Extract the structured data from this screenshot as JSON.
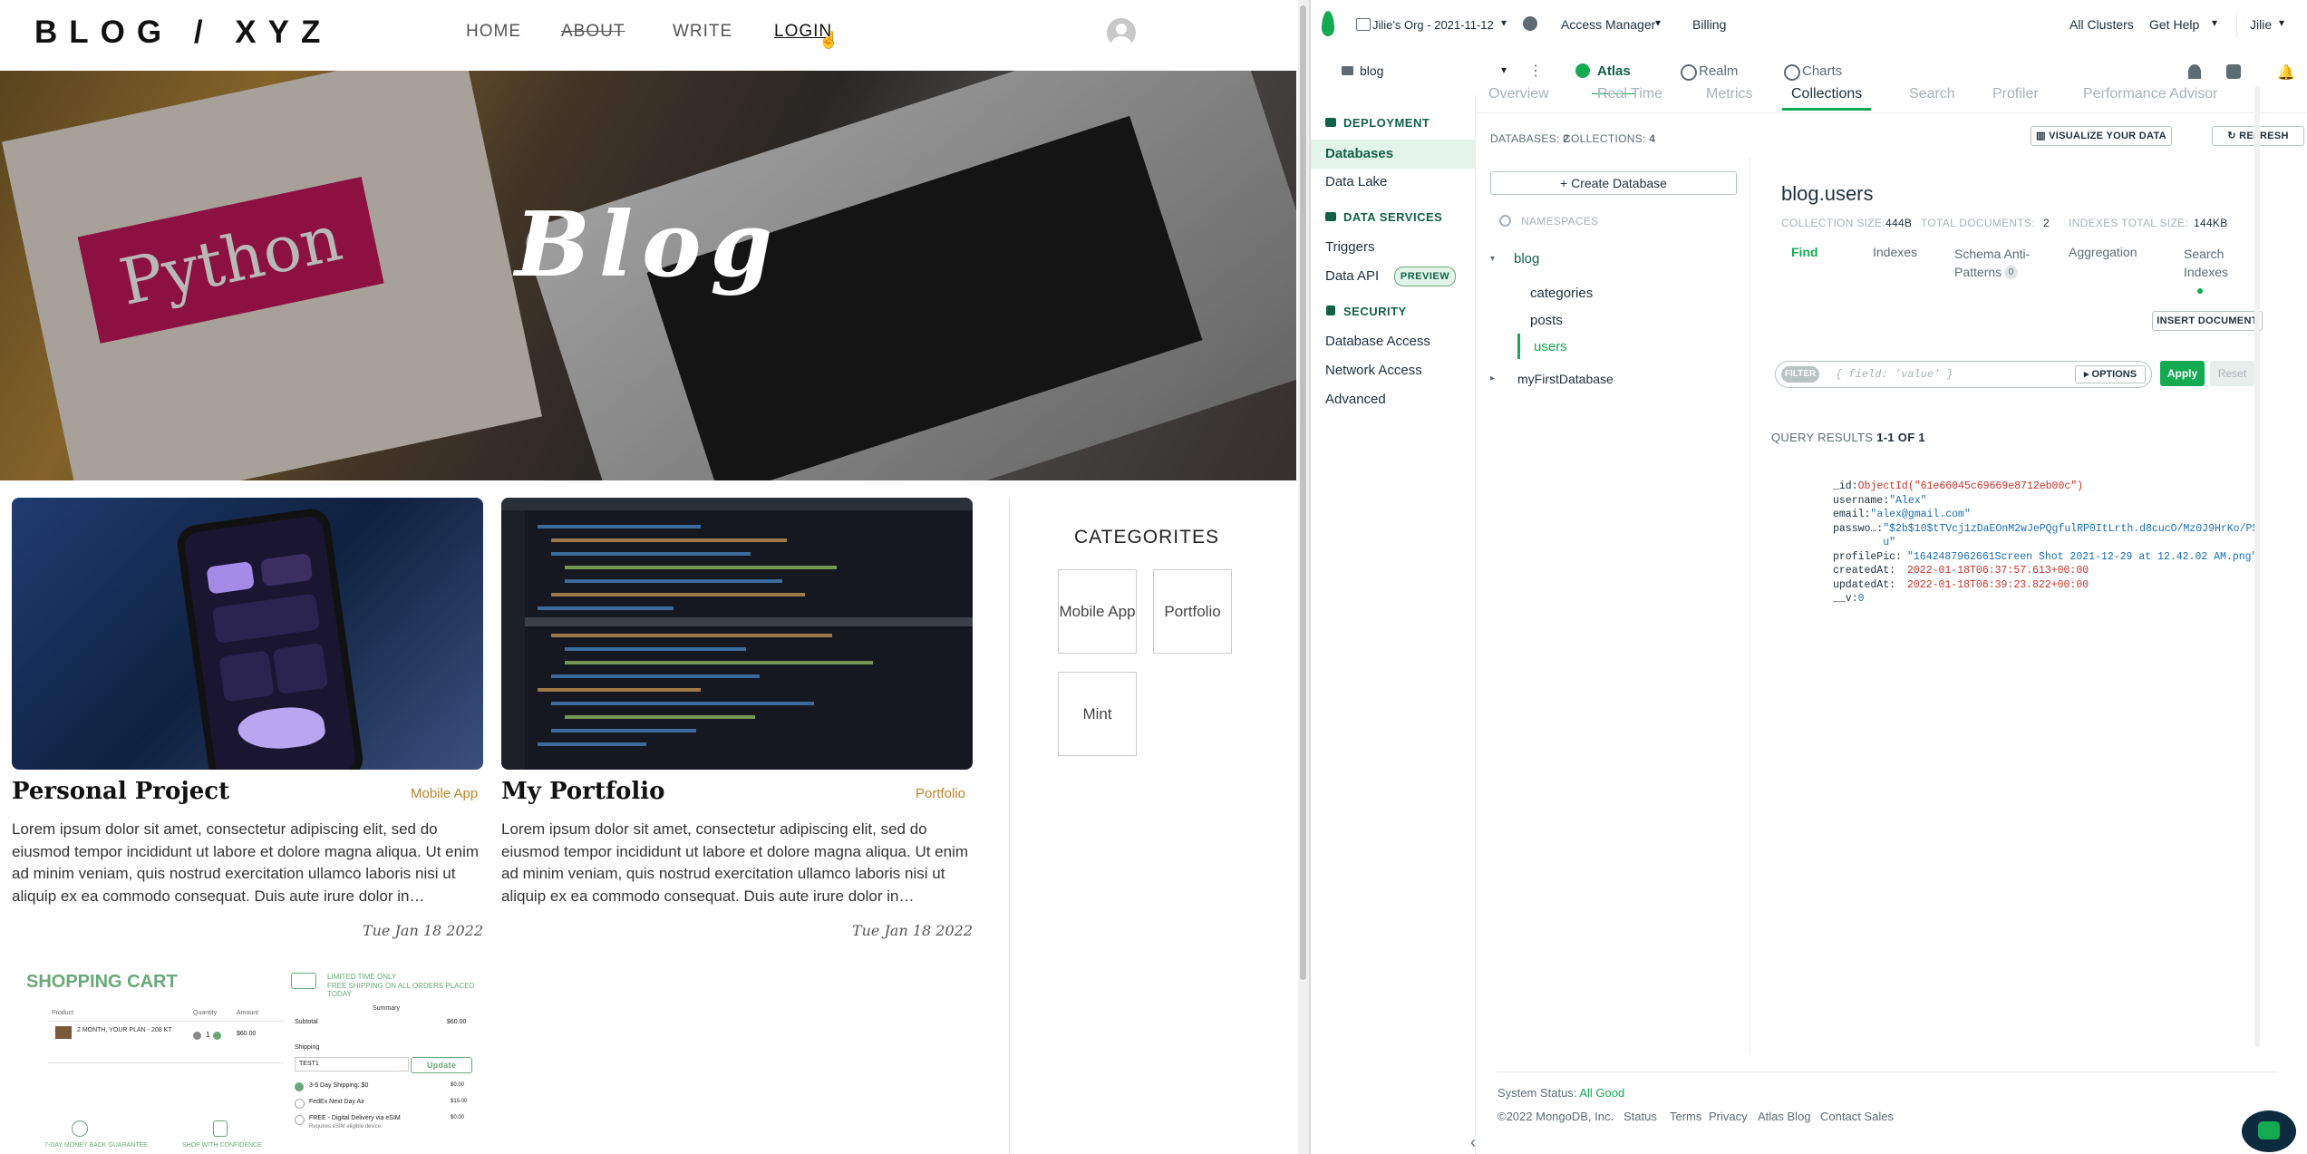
{
  "blog": {
    "logo": "BLOG / XYZ",
    "nav": {
      "home": "HOME",
      "about": "ABOUT",
      "write": "WRITE",
      "login": "LOGIN"
    },
    "hero": {
      "title": "Blog",
      "book_text": "Python"
    },
    "posts": [
      {
        "title": "Personal Project",
        "category": "Mobile App",
        "excerpt": "Lorem ipsum dolor sit amet, consectetur adipiscing elit, sed do eiusmod tempor incididunt ut labore et dolore magna aliqua. Ut enim ad minim veniam, quis nostrud exercitation ullamco laboris nisi ut aliquip ex ea commodo consequat. Duis aute irure dolor in…",
        "date": "Tue Jan 18 2022"
      },
      {
        "title": "My Portfolio",
        "category": "Portfolio",
        "excerpt": "Lorem ipsum dolor sit amet, consectetur adipiscing elit, sed do eiusmod tempor incididunt ut labore et dolore magna aliqua. Ut enim ad minim veniam, quis nostrud exercitation ullamco laboris nisi ut aliquip ex ea commodo consequat. Duis aute irure dolor in…",
        "date": "Tue Jan 18 2022"
      }
    ],
    "categories_title": "CATEGORITES",
    "categories": [
      "Mobile App",
      "Portfolio",
      "Mint"
    ],
    "cart": {
      "title": "SHOPPING CART",
      "promo_line1": "LIMITED TIME ONLY",
      "promo_line2": "FREE SHIPPING ON ALL ORDERS PLACED TODAY",
      "col_product": "Product",
      "col_quantity": "Quantity",
      "col_amount": "Amount",
      "item": "2 MONTH, YOUR PLAN - 208 KT",
      "qty": "1",
      "amount": "$60.00",
      "summary": "Summary",
      "subtotal_label": "Subtotal",
      "subtotal": "$60.00",
      "shipping_label": "Shipping",
      "promo_value": "TEST1",
      "update": "Update",
      "ship1": "3-5 Day Shipping: $0",
      "ship1_price": "$0.00",
      "ship2": "FedEx Next Day Air",
      "ship2_price": "$15.00",
      "ship3": "FREE - Digital Delivery via eSIM",
      "ship3_note": "Requires eSIM eligible device",
      "ship3_price": "$0.00",
      "badge1": "7-DAY MONEY BACK GUARANTEE",
      "badge2": "SHOP WITH CONFIDENCE"
    }
  },
  "atlas": {
    "org": "Jilie's Org - 2021-11-12",
    "access_manager": "Access Manager",
    "billing": "Billing",
    "all_clusters": "All Clusters",
    "get_help": "Get Help",
    "user": "Jilie",
    "project": "blog",
    "top_tabs": [
      "Atlas",
      "Realm",
      "Charts"
    ],
    "sidebar": {
      "deployment": "DEPLOYMENT",
      "databases": "Databases",
      "data_lake": "Data Lake",
      "data_services": "DATA SERVICES",
      "triggers": "Triggers",
      "data_api": "Data API",
      "preview": "PREVIEW",
      "security": "SECURITY",
      "database_access": "Database Access",
      "network_access": "Network Access",
      "advanced": "Advanced"
    },
    "cluster_tabs": [
      "Overview",
      "Real Time",
      "Metrics",
      "Collections",
      "Search",
      "Profiler",
      "Performance Advisor"
    ],
    "databases_label": "DATABASES:",
    "databases_count": "2",
    "collections_label": "COLLECTIONS:",
    "collections_count": "4",
    "visualize": "VISUALIZE YOUR DATA",
    "refresh": "REFRESH",
    "create_db": "+ Create Database",
    "namespaces": "NAMESPACES",
    "tree": {
      "db1": "blog",
      "collections": [
        "categories",
        "posts",
        "users"
      ],
      "db2": "myFirstDatabase"
    },
    "collection": {
      "name": "blog.users",
      "size_label": "COLLECTION SIZE:",
      "size": "444B",
      "docs_label": "TOTAL DOCUMENTS:",
      "docs": "2",
      "idx_label": "INDEXES TOTAL SIZE:",
      "idx": "144KB"
    },
    "sub_tabs": [
      "Find",
      "Indexes",
      "Schema Anti-Patterns",
      "Aggregation",
      "Search Indexes"
    ],
    "schema_count": "0",
    "insert_doc": "INSERT DOCUMENT",
    "filter_label": "FILTER",
    "filter_placeholder": "{ field: 'value' }",
    "options": "OPTIONS",
    "apply": "Apply",
    "reset": "Reset",
    "results_label": "QUERY RESULTS",
    "results_range": "1-1 OF 1",
    "doc": [
      {
        "key": "_id:",
        "value": "ObjectId(\"61e66045c69669e8712eb00c\")",
        "type": "oid"
      },
      {
        "key": "username:",
        "value": "\"Alex\"",
        "type": "str"
      },
      {
        "key": "email:",
        "value": "\"alex@gmail.com\"",
        "type": "str"
      },
      {
        "key": "passwo…:",
        "value": "\"$2b$10$tTVcj1zDaEOnM2wJePQgfulRP0ItLrth.d8cucO/Mz0J9HrKo/PSu\"",
        "type": "str"
      },
      {
        "key": "profilePic:",
        "value": "\"1642487962661Screen Shot 2021-12-29 at 12.42.02 AM.png\"",
        "type": "str"
      },
      {
        "key": "createdAt:",
        "value": "2022-01-18T06:37:57.613+00:00",
        "type": "date"
      },
      {
        "key": "updatedAt:",
        "value": "2022-01-18T06:39:23.822+00:00",
        "type": "date"
      },
      {
        "key": "__v:",
        "value": "0",
        "type": "num"
      }
    ],
    "footer": {
      "status_label": "System Status:",
      "status": "All Good",
      "copyright": "©2022 MongoDB, Inc.",
      "links": [
        "Status",
        "Terms",
        "Privacy",
        "Atlas Blog",
        "Contact Sales"
      ]
    }
  }
}
